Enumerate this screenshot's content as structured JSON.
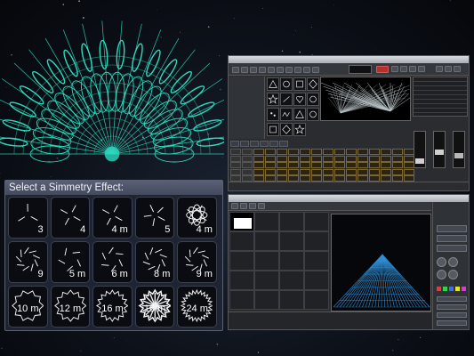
{
  "symmetry_panel": {
    "title": "Select a Simmetry Effect:",
    "effects": [
      {
        "label": "3",
        "icon": "three-fold-lines-icon"
      },
      {
        "label": "4",
        "icon": "four-fold-lines-icon"
      },
      {
        "label": "4 m",
        "icon": "four-fold-mirror-icon"
      },
      {
        "label": "5",
        "icon": "five-fold-lines-icon"
      },
      {
        "label": "4 m",
        "icon": "four-fold-flower-icon"
      },
      {
        "label": "9",
        "icon": "nine-fold-spiral-icon"
      },
      {
        "label": "5 m",
        "icon": "five-fold-star-icon"
      },
      {
        "label": "6 m",
        "icon": "hexagon-mirror-icon"
      },
      {
        "label": "8 m",
        "icon": "eight-fold-mirror-icon"
      },
      {
        "label": "9 m",
        "icon": "nine-fold-ring-icon"
      },
      {
        "label": "10 m",
        "icon": "ten-fold-ring-icon"
      },
      {
        "label": "12 m",
        "icon": "twelve-fold-gear-icon"
      },
      {
        "label": "16 m",
        "icon": "sixteen-fold-ring-icon"
      },
      {
        "label": "16 m",
        "icon": "sixteen-fold-burst-icon"
      },
      {
        "label": "24 m",
        "icon": "twenty-four-fold-gear-icon"
      }
    ]
  },
  "colors": {
    "mandala": "#2ee6c8",
    "laser_beams": "#d8e4e8",
    "pyramid": "#2f8fd6",
    "panel_header": "#5a6075",
    "window_chrome": "#2a2c30",
    "sequence_cell": "#7a6630"
  },
  "icons": [
    "mandala-graphic-icon",
    "laser-beams-preview-icon",
    "laser-pyramid-preview-icon"
  ]
}
